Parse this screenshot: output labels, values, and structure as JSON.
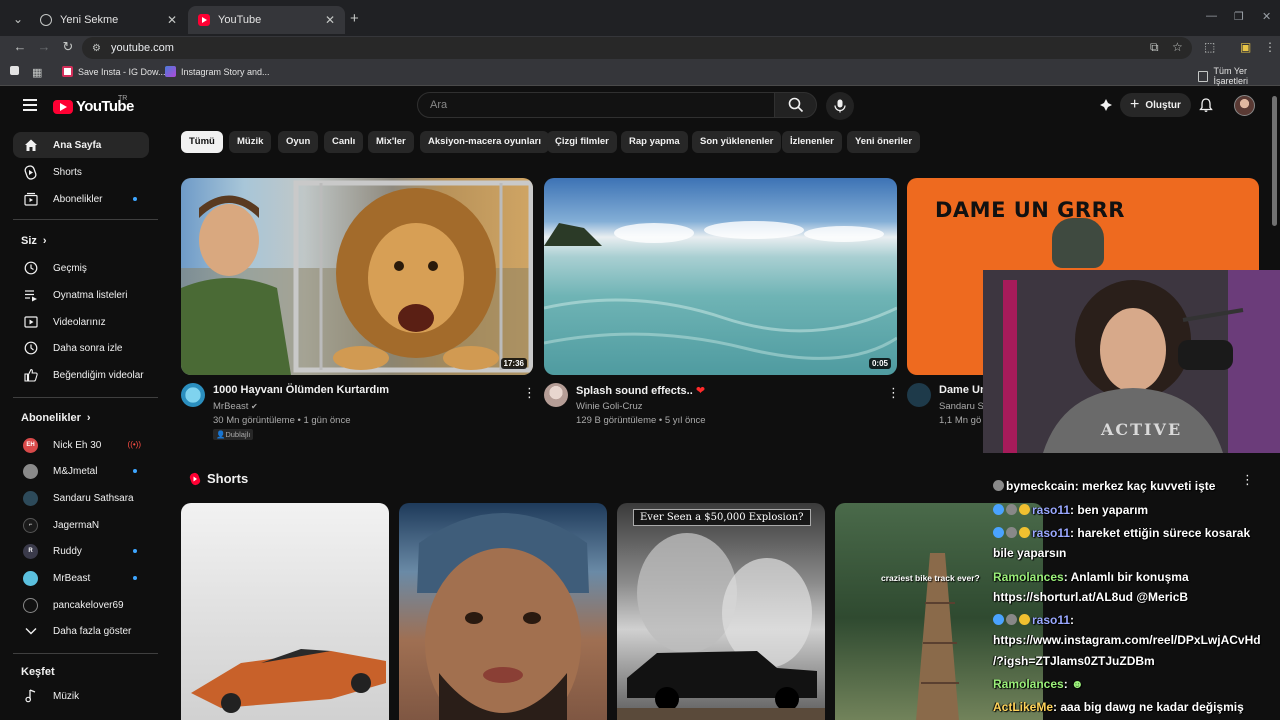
{
  "browser": {
    "tabs": [
      {
        "title": "Yeni Sekme",
        "favicon": "globe-icon",
        "active": false
      },
      {
        "title": "YouTube",
        "favicon": "youtube-icon",
        "active": true
      }
    ],
    "url": "youtube.com",
    "bookmarks": [
      {
        "label": "Save Insta - IG Dow...",
        "favicon": "instagram-icon"
      },
      {
        "label": "Instagram Story and...",
        "favicon": "image-icon"
      }
    ],
    "all_bookmarks_label": "Tüm Yer İşaretleri"
  },
  "youtube": {
    "logo_text": "YouTube",
    "country_code": "TR",
    "search_placeholder": "Ara",
    "create_label": "Oluştur",
    "accent_color": "#ff0033"
  },
  "sidebar": {
    "main": [
      {
        "label": "Ana Sayfa",
        "icon": "home-icon",
        "active": true
      },
      {
        "label": "Shorts",
        "icon": "shorts-icon"
      },
      {
        "label": "Abonelikler",
        "icon": "subscriptions-icon",
        "new": true
      }
    ],
    "you_header": "Siz",
    "you": [
      {
        "label": "Geçmiş",
        "icon": "history-icon"
      },
      {
        "label": "Oynatma listeleri",
        "icon": "playlists-icon"
      },
      {
        "label": "Videolarınız",
        "icon": "your-videos-icon"
      },
      {
        "label": "Daha sonra izle",
        "icon": "watch-later-icon"
      },
      {
        "label": "Beğendiğim videolar",
        "icon": "liked-videos-icon"
      }
    ],
    "subs_header": "Abonelikler",
    "subscriptions": [
      {
        "label": "Nick Eh 30",
        "live": true
      },
      {
        "label": "M&Jmetal",
        "new": true
      },
      {
        "label": "Sandaru Sathsara"
      },
      {
        "label": "JagermaN"
      },
      {
        "label": "Ruddy",
        "new": true
      },
      {
        "label": "MrBeast",
        "new": true
      },
      {
        "label": "pancakelover69"
      }
    ],
    "show_more": "Daha fazla göster",
    "explore_header": "Keşfet",
    "explore": [
      {
        "label": "Müzik",
        "icon": "music-icon"
      }
    ]
  },
  "chips": [
    "Tümü",
    "Müzik",
    "Oyun",
    "Canlı",
    "Mix'ler",
    "Aksiyon-macera oyunları",
    "Çizgi filmler",
    "Rap yapma",
    "Son yüklenenler",
    "İzlenenler",
    "Yeni öneriler"
  ],
  "videos": [
    {
      "title": "1000 Hayvanı Ölümden Kurtardım",
      "channel": "MrBeast",
      "verified": true,
      "stats": "30 Mn görüntüleme • 1 gün önce",
      "badge": "Dublajlı",
      "duration": "17:36"
    },
    {
      "title": "Splash sound effects..",
      "title_emoji": "❤",
      "channel": "Winie Goli-Cruz",
      "stats": "129 B görüntüleme • 5 yıl önce",
      "duration": "0:05"
    },
    {
      "title": "Dame Un",
      "channel": "Sandaru Sa",
      "stats": "1,1 Mn gö",
      "thumb_text": "DAME UN GRRR"
    }
  ],
  "shorts": {
    "header": "Shorts",
    "items": [
      {
        "overlay": ""
      },
      {
        "overlay": ""
      },
      {
        "overlay": "Ever Seen a $50,000 Explosion?"
      },
      {
        "overlay": "craziest bike track ever?"
      }
    ]
  },
  "chat": [
    {
      "user": "bymeckcain",
      "msg": ": merkez kaç kuvveti işte",
      "color": "#ffffff"
    },
    {
      "user": "raso11",
      "msg": ": ben yaparım",
      "color": "#9aa8ff"
    },
    {
      "user": "raso11",
      "msg": ": hareket ettiğin sürece kosarak",
      "color": "#9aa8ff"
    },
    {
      "user": "",
      "msg": "bile yaparsın",
      "color": "#ffffff"
    },
    {
      "user": "Ramolances",
      "msg": ": Anlamlı bir konuşma",
      "color": "#9bf07a"
    },
    {
      "user": "",
      "msg": "https://shorturl.at/AL8ud @MericB",
      "color": "#ffffff"
    },
    {
      "user": "raso11",
      "msg": ":",
      "color": "#9aa8ff"
    },
    {
      "user": "",
      "msg": "https://www.instagram.com/reel/DPxLwjACvHd",
      "color": "#ffffff"
    },
    {
      "user": "",
      "msg": "/?igsh=ZTJlams0ZTJuZDBm",
      "color": "#ffffff"
    },
    {
      "user": "Ramolances",
      "msg": ":",
      "color": "#9bf07a"
    },
    {
      "user": "ActLikeMe",
      "msg": ": aaa big dawg ne kadar değişmiş",
      "color": "#ffd35a"
    }
  ],
  "webcam": {
    "shirt_text": "ACTIVE"
  }
}
